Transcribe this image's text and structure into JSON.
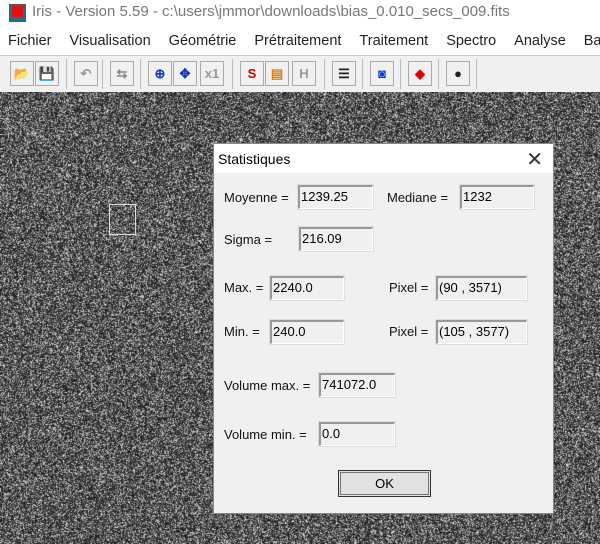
{
  "window": {
    "title": "Iris - Version 5.59 - c:\\users\\jmmor\\downloads\\bias_0.010_secs_009.fits"
  },
  "menu": [
    "Fichier",
    "Visualisation",
    "Géométrie",
    "Prétraitement",
    "Traitement",
    "Spectro",
    "Analyse",
    "Ba"
  ],
  "toolbar": [
    {
      "name": "open-folder-icon",
      "glyph": "📂"
    },
    {
      "name": "save-icon",
      "glyph": "💾"
    },
    {
      "name": "undo-icon",
      "glyph": "↶"
    },
    {
      "name": "threshold-icon",
      "glyph": "⇆"
    },
    {
      "name": "center-target-icon",
      "glyph": "⊕"
    },
    {
      "name": "move-arrows-icon",
      "glyph": "✥"
    },
    {
      "name": "zoom-x1-icon",
      "glyph": "x1"
    },
    {
      "name": "refresh-red-icon",
      "glyph": "S"
    },
    {
      "name": "palette-icon",
      "glyph": "▤"
    },
    {
      "name": "histogram-h-icon",
      "glyph": "H"
    },
    {
      "name": "list-icon",
      "glyph": "☰"
    },
    {
      "name": "camera-icon",
      "glyph": "◙"
    },
    {
      "name": "blue-diamond-icon",
      "glyph": "◆"
    },
    {
      "name": "red-dot-icon",
      "glyph": "●"
    }
  ],
  "dialog": {
    "title": "Statistiques",
    "moyenne_label": "Moyenne =",
    "moyenne": "1239.25",
    "mediane_label": "Mediane =",
    "mediane": "1232",
    "sigma_label": "Sigma =",
    "sigma": "216.09",
    "max_label": "Max. =",
    "max": "2240.0",
    "max_pixel_label": "Pixel =",
    "max_pixel": "(90 , 3571)",
    "min_label": "Min. =",
    "min": "240.0",
    "min_pixel_label": "Pixel =",
    "min_pixel": "(105 , 3577)",
    "volmax_label": "Volume max. =",
    "volmax": "741072.0",
    "volmin_label": "Volume min. =",
    "volmin": "0.0",
    "ok": "OK",
    "close": "✕"
  }
}
